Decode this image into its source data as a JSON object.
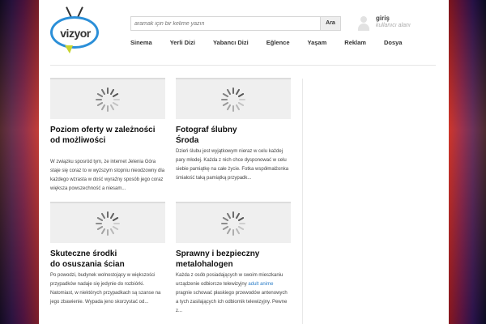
{
  "brand": {
    "logo_text": "vizyor"
  },
  "search": {
    "placeholder": "aramak için bir kelime yazın",
    "button_label": "Ara"
  },
  "login": {
    "label": "giriş",
    "sublabel": "kullanıcı alanı"
  },
  "nav": {
    "items": [
      "Sinema",
      "Yerli Dizi",
      "Yabancı Dizi",
      "Eğlence",
      "Yaşam",
      "Reklam",
      "Dosya"
    ]
  },
  "colors": {
    "accent_link": "#2a7cc7",
    "logo_ring": "#2b8fd8"
  },
  "cards": [
    {
      "title": "Poziom oferty w zależności od możliwości",
      "excerpt": "W związku sposród tym, że internet Jelenia Góra staje się coraz to w wyższym stopniu nieodzowny dla każdego wzrasta w dość wyraźny sposób jego coraz większa powszechność a niesam..."
    },
    {
      "title": "Fotograf ślubny Środa",
      "excerpt": "Dzień ślubu jest wyjątkowym nieraz w celu każdej pary młodej. Każda z nich chce dysponować w celu siebie pamiątkę na całe życie. Fotka współmałżonka śmiałość taką pamiątką przypadk..."
    },
    {
      "title": "Skuteczne środki do osuszania ścian",
      "excerpt": "Po powodzi, budynek wolnostojący w większości przypadków nadaje się jedynie do rozbiórki. Natomiast, w niektórych przypadkach są szanse na jego zbawienie. Wypada jeno skorzystać od..."
    },
    {
      "title": "Sprawny i bezpieczny metalohalogen",
      "excerpt_before": "Każda z osób posiadających w swoim mieszkaniu urządzenie odbiorcze telewizyjny ",
      "excerpt_link": "adult anime",
      "excerpt_after": " pragnie schować płaskiego przewodów antenowych a tych zasilających ich odbiornik telewizyjny. Pewne z..."
    }
  ]
}
